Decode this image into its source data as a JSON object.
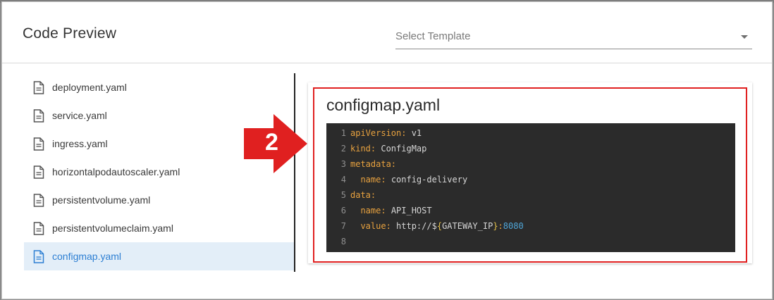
{
  "dialog": {
    "title": "Code Preview",
    "template_select": {
      "placeholder": "Select Template",
      "value": ""
    }
  },
  "files": [
    {
      "name": "deployment.yaml",
      "active": false
    },
    {
      "name": "service.yaml",
      "active": false
    },
    {
      "name": "ingress.yaml",
      "active": false
    },
    {
      "name": "horizontalpodautoscaler.yaml",
      "active": false
    },
    {
      "name": "persistentvolume.yaml",
      "active": false
    },
    {
      "name": "persistentvolumeclaim.yaml",
      "active": false
    },
    {
      "name": "configmap.yaml",
      "active": true
    }
  ],
  "preview": {
    "title": "configmap.yaml",
    "lines": [
      {
        "n": "1",
        "indent": "",
        "key": "apiVersion",
        "sep": ": ",
        "val": "v1"
      },
      {
        "n": "2",
        "indent": "",
        "key": "kind",
        "sep": ": ",
        "val": "ConfigMap"
      },
      {
        "n": "3",
        "indent": "",
        "key": "metadata",
        "sep": ":",
        "val": ""
      },
      {
        "n": "4",
        "indent": "  ",
        "key": "name",
        "sep": ": ",
        "val": "config-delivery"
      },
      {
        "n": "5",
        "indent": "",
        "key": "data",
        "sep": ":",
        "val": ""
      },
      {
        "n": "6",
        "indent": "  ",
        "key": "name",
        "sep": ": ",
        "val": "API_HOST"
      },
      {
        "n": "7",
        "indent": "  ",
        "key": "value",
        "sep": ": ",
        "val": "http://$",
        "brace_open": "{",
        "var": "GATEWAY_IP",
        "brace_close": "}",
        "colon": ":",
        "port": "8080"
      },
      {
        "n": "8",
        "indent": "",
        "key": "",
        "sep": "",
        "val": ""
      }
    ]
  },
  "annotation": {
    "step": "2",
    "color": "#e02020"
  },
  "colors": {
    "accent": "#2d7fd3",
    "active_bg": "#e3eef8",
    "code_bg": "#2b2b2b",
    "yaml_key": "#e8a23f",
    "yaml_number": "#4fa6d8"
  }
}
